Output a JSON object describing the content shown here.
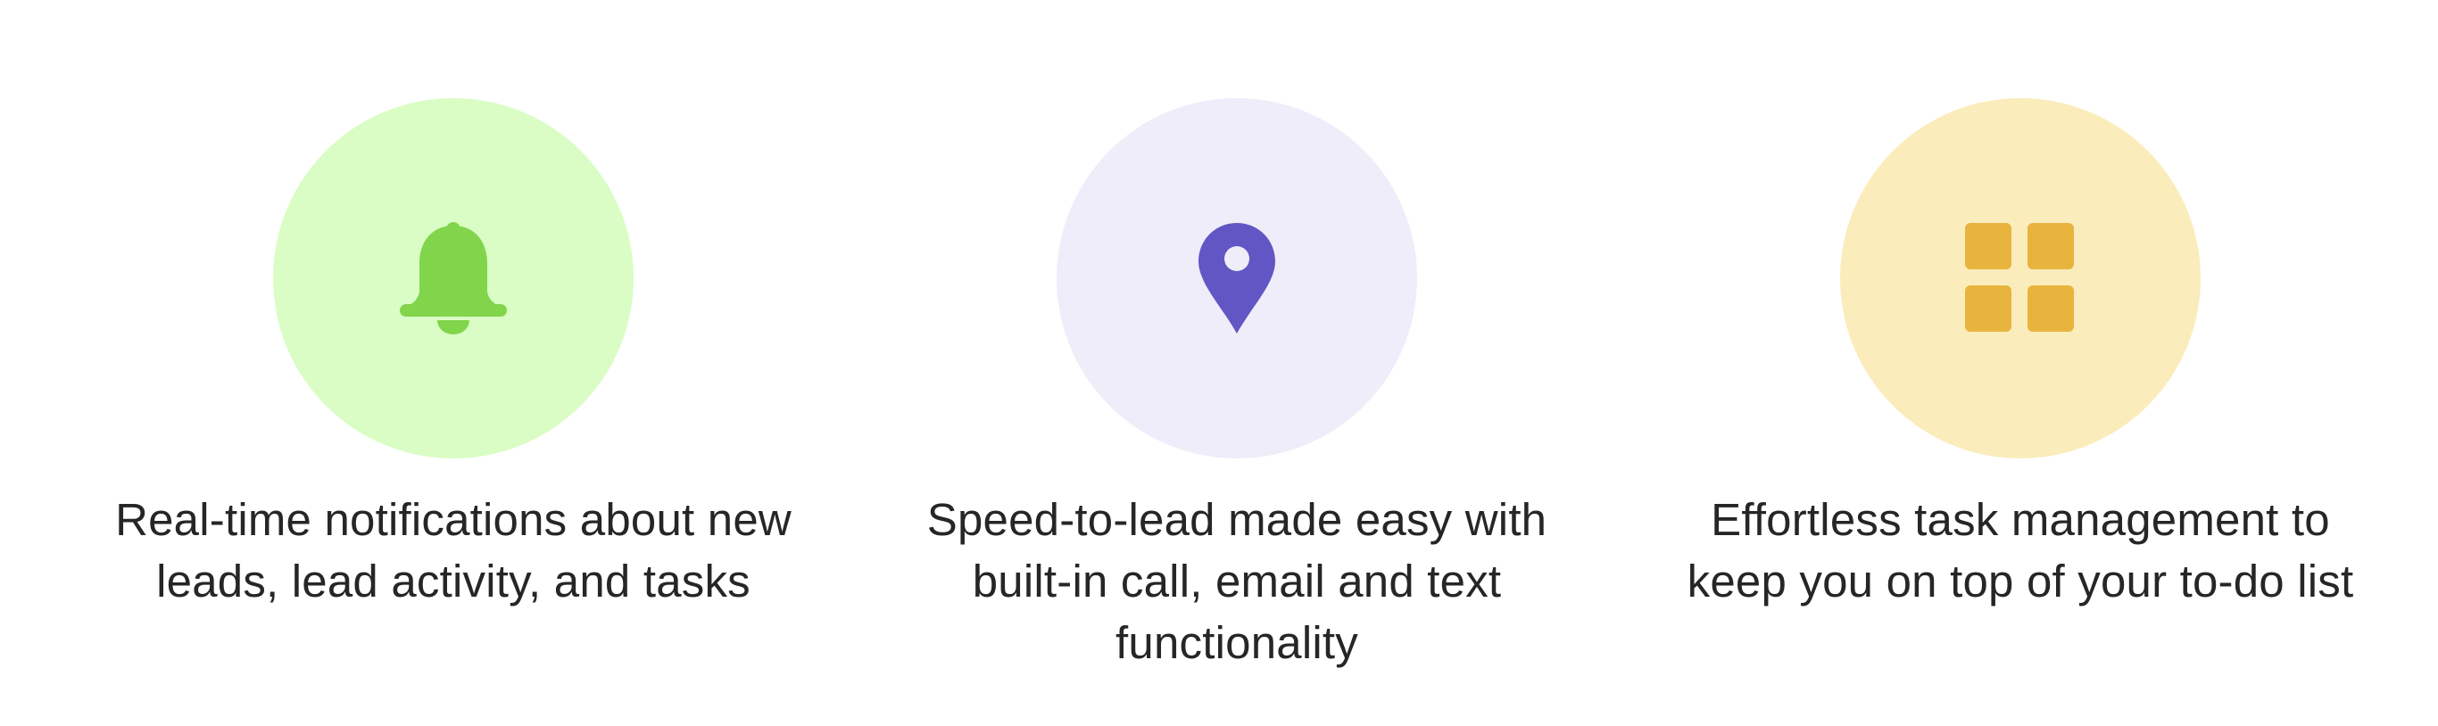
{
  "features": [
    {
      "icon": "bell-icon",
      "circle_color": "#d9fdc4",
      "icon_color": "#82d54b",
      "lines": [
        "Real-time notifications about new",
        "leads, lead activity, and tasks"
      ]
    },
    {
      "icon": "map-pin-icon",
      "circle_color": "#efedf9",
      "icon_color": "#6256c4",
      "lines": [
        "Speed-to-lead made easy with",
        "built-in call, email and text",
        "functionality"
      ]
    },
    {
      "icon": "grid-icon",
      "circle_color": "#fbecbb",
      "icon_color": "#e8b43e",
      "lines": [
        "Effortless task management to",
        "keep you on top of your to-do list"
      ]
    }
  ]
}
